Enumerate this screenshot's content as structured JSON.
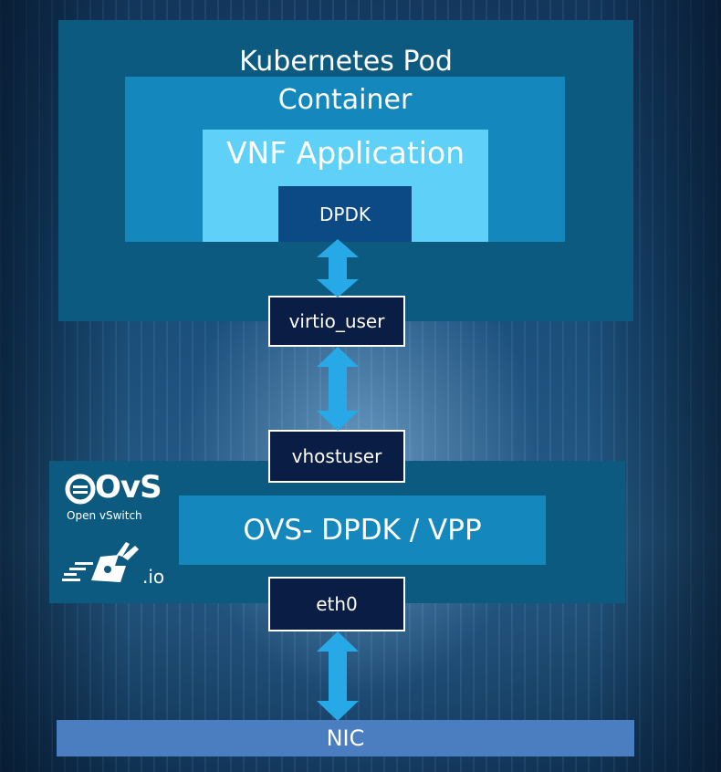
{
  "pod": {
    "title": "Kubernetes Pod"
  },
  "container": {
    "title": "Container"
  },
  "vnf": {
    "title": "VNF Application"
  },
  "dpdk": {
    "label": "DPDK"
  },
  "virtio": {
    "label": "virtio_user"
  },
  "vhost": {
    "label": "vhostuser"
  },
  "ovs": {
    "label": "OVS- DPDK / VPP"
  },
  "eth0": {
    "label": "eth0"
  },
  "nic": {
    "label": "NIC"
  },
  "logos": {
    "ovs_mark": "OvS",
    "ovs_sub": "Open vSwitch",
    "fdio_suffix": ".io"
  },
  "colors": {
    "pod": "#0d5a80",
    "container": "#1487bd",
    "vnf": "#5fd0f8",
    "dpdk": "#0c4a85",
    "label_box": "#0a1d44",
    "nic": "#4a7ec0",
    "arrow": "#27a9e8"
  }
}
